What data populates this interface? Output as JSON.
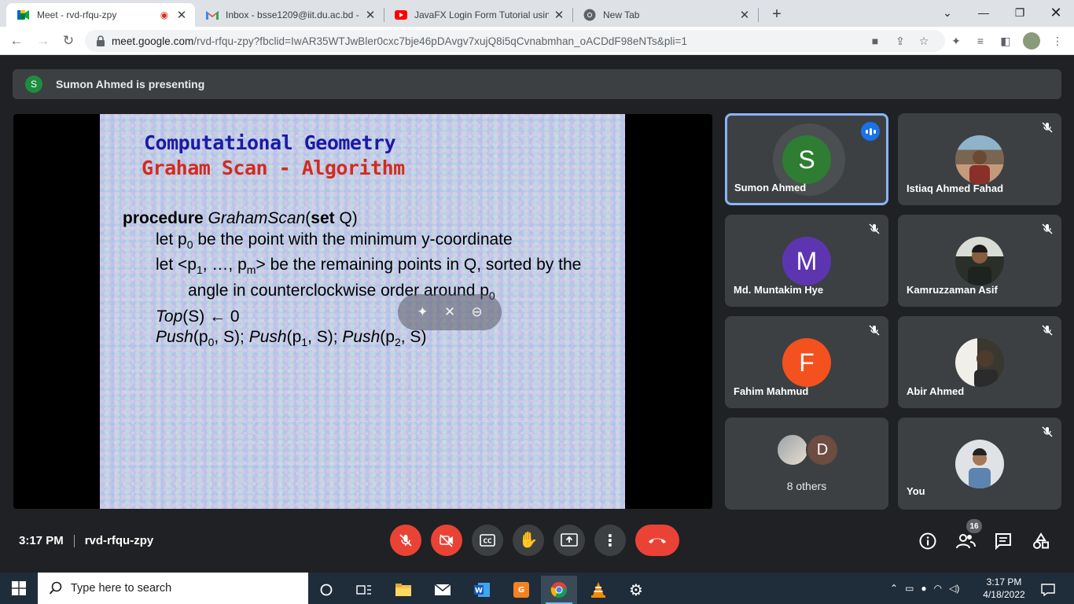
{
  "browser": {
    "tabs": [
      {
        "title": "Meet - rvd-rfqu-zpy",
        "active": true
      },
      {
        "title": "Inbox - bsse1209@iit.du.ac.bd - I"
      },
      {
        "title": "JavaFX Login Form Tutorial using"
      },
      {
        "title": "New Tab"
      }
    ],
    "url_host": "meet.google.com",
    "url_path": "/rvd-rfqu-zpy?fbclid=IwAR35WTJwBler0cxc7bje46pDAvgv7xujQ8i5qCvnabmhan_oACDdF98eNTs&pli=1"
  },
  "meet": {
    "presenter_initial": "S",
    "presenting_text": "Sumon Ahmed is presenting",
    "slide": {
      "title_line1": "Computational Geometry",
      "title_line2": "Graham Scan - Algorithm",
      "proc_kw": "procedure",
      "proc_name": "GrahamScan",
      "proc_open": "(",
      "proc_set": "set",
      "proc_rest": " Q)",
      "line2_a": "let p",
      "line2_sub": "0",
      "line2_b": " be the point with the minimum y-coordinate",
      "line3_a": "let <p",
      "line3_sub1": "1",
      "line3_b": ", …, p",
      "line3_sub2": "m",
      "line3_c": "> be the remaining points in  Q, sorted by the",
      "line4_a": "angle in counterclockwise order around p",
      "line4_sub": "0",
      "line5_a": "Top",
      "line5_b": "(S) ← 0",
      "line6_push1": "Push",
      "line6_a": "(p",
      "line6_sub1": "0",
      "line6_b": ", S); ",
      "line6_push2": "Push",
      "line6_c": "(p",
      "line6_sub2": "1",
      "line6_d": ", S); ",
      "line6_push3": "Push",
      "line6_e": "(p",
      "line6_sub3": "2",
      "line6_f": ", S)"
    },
    "participants": [
      {
        "name": "Sumon Ahmed",
        "initial": "S",
        "avatar_color": "#2e7d32",
        "speaking": true
      },
      {
        "name": "Istiaq Ahmed Fahad",
        "muted": true,
        "photo": "person-photo"
      },
      {
        "name": "Md. Muntakim Hye",
        "initial": "M",
        "avatar_color": "#5e35b1",
        "muted": true
      },
      {
        "name": "Kamruzzaman Asif",
        "muted": true,
        "photo": "person-photo"
      },
      {
        "name": "Fahim Mahmud",
        "initial": "F",
        "avatar_color": "#f4511e",
        "muted": true
      },
      {
        "name": "Abir Ahmed",
        "muted": true,
        "photo": "person-photo"
      },
      {
        "name": "8 others",
        "initial": "D",
        "avatar_color": "#6d4c41"
      },
      {
        "name": "You",
        "muted": true,
        "photo": "person-photo"
      }
    ],
    "time": "3:17 PM",
    "meeting_code": "rvd-rfqu-zpy",
    "people_count": "16"
  },
  "taskbar": {
    "search_placeholder": "Type here to search",
    "time": "3:17 PM",
    "date": "4/18/2022"
  }
}
